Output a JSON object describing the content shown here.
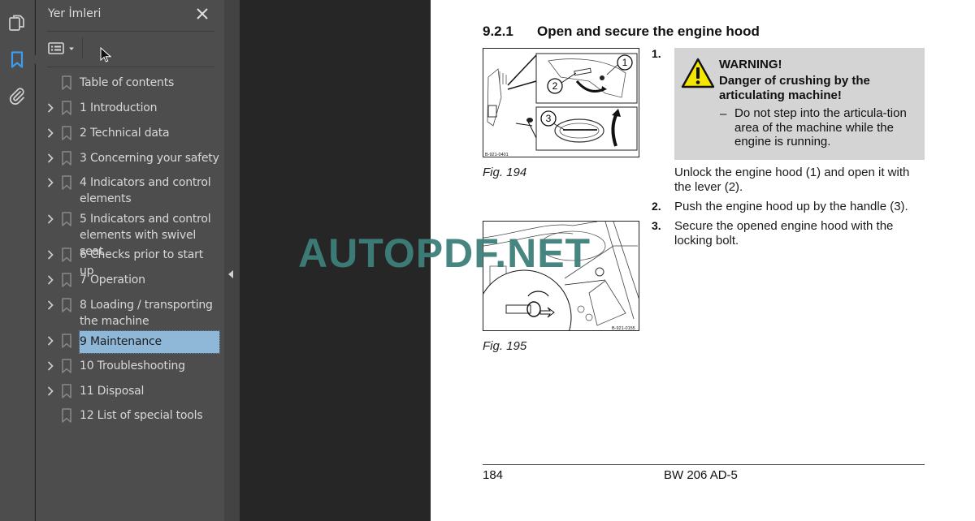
{
  "rail": {
    "items": [
      {
        "icon": "pages-icon",
        "active": false
      },
      {
        "icon": "bookmark-icon",
        "active": true
      },
      {
        "icon": "paperclip-icon",
        "active": false
      }
    ],
    "active_color": "#3b9cf2"
  },
  "panel": {
    "title": "Yer İmleri",
    "bookmarks": [
      {
        "label": "Table of contents",
        "expandable": false,
        "selected": false
      },
      {
        "label": "1 Introduction",
        "expandable": true,
        "selected": false
      },
      {
        "label": "2 Technical data",
        "expandable": true,
        "selected": false
      },
      {
        "label": "3 Concerning your safety",
        "expandable": true,
        "selected": false
      },
      {
        "label": "4 Indicators and control elements",
        "expandable": true,
        "selected": false
      },
      {
        "label": "5 Indicators and control elements with swivel seat",
        "expandable": true,
        "selected": false
      },
      {
        "label": "6 Checks prior to start up",
        "expandable": true,
        "selected": false
      },
      {
        "label": "7 Operation",
        "expandable": true,
        "selected": false
      },
      {
        "label": "8 Loading / transporting the machine",
        "expandable": true,
        "selected": false
      },
      {
        "label": "9 Maintenance",
        "expandable": true,
        "selected": true
      },
      {
        "label": "10 Troubleshooting",
        "expandable": true,
        "selected": false
      },
      {
        "label": "11 Disposal",
        "expandable": true,
        "selected": false
      },
      {
        "label": "12 List of special tools",
        "expandable": false,
        "selected": false
      }
    ],
    "selected_color": "#8fb8d8"
  },
  "page": {
    "section_number": "9.2.1",
    "section_title": "Open and secure the engine hood",
    "figures": [
      {
        "caption": "Fig.  194",
        "code": "B-921-0401",
        "callouts": [
          "1",
          "2",
          "3"
        ]
      },
      {
        "caption": "Fig.  195",
        "code": "B-921-0155"
      }
    ],
    "warning": {
      "title": "WARNING!",
      "subtitle": "Danger of crushing by the articulating machine!",
      "dash": "–",
      "text": "Do not step into the articula-tion area of the machine while the engine is running."
    },
    "steps": [
      {
        "num": "1.",
        "text": "Unlock the engine hood (1) and open it with the lever (2)."
      },
      {
        "num": "2.",
        "text": "Push the engine hood up by the handle (3)."
      },
      {
        "num": "3.",
        "text": "Secure the opened engine hood with the locking bolt."
      }
    ],
    "footer": {
      "page_number": "184",
      "model": "BW 206 AD-5"
    }
  },
  "watermark": {
    "text": "AUTOPDF.NET",
    "color": "#3d7f7a"
  }
}
